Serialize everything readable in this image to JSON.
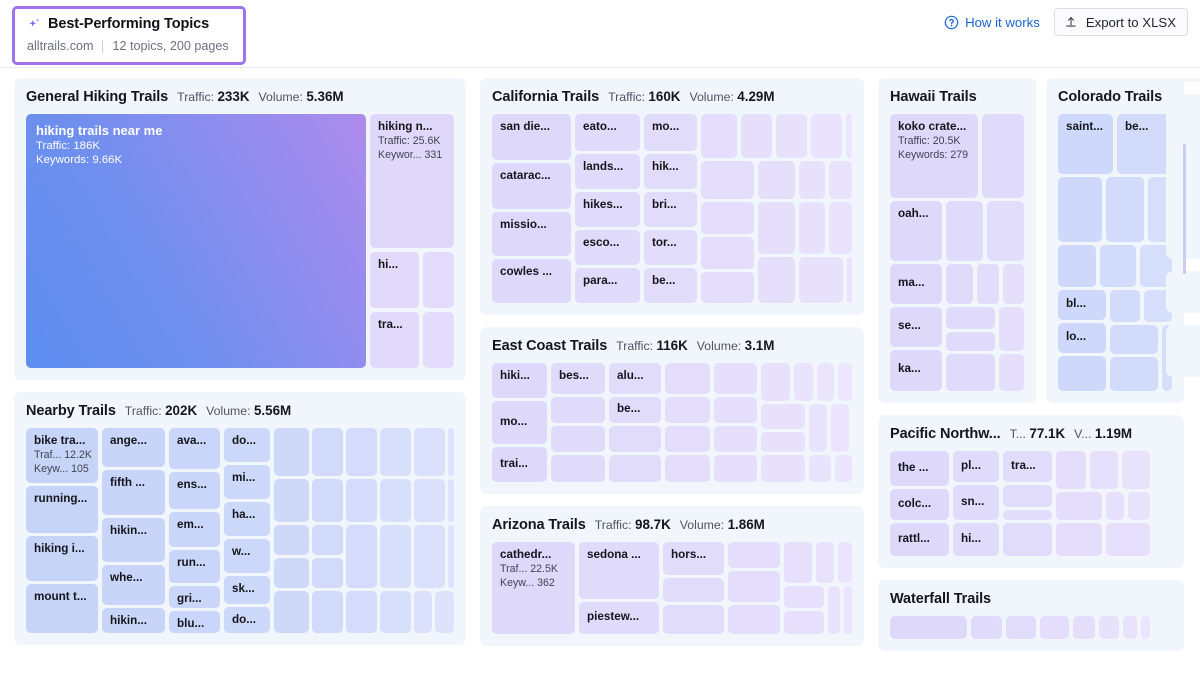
{
  "header": {
    "sparkle_icon": "sparkle-icon",
    "title": "Best-Performing Topics",
    "domain": "alltrails.com",
    "summary": "12 topics, 200 pages",
    "how_it_works": "How it works",
    "how_it_works_icon": "question-circle-icon",
    "export_label": "Export to XLSX",
    "export_icon": "upload-icon"
  },
  "labels": {
    "traffic": "Traffic:",
    "volume": "Volume:"
  },
  "colors": {
    "accent_purple": "#a072ef",
    "link_blue": "#1a63d8",
    "panel_bg": "#f1f5fc",
    "tile_blue": "#c5d3f8",
    "tile_lavender": "#ded9fb",
    "hero_gradient_from": "#5d8ef0",
    "hero_gradient_to": "#ad8bec"
  },
  "chart_data": {
    "type": "treemap",
    "title": "Best-Performing Topics",
    "groups": [
      {
        "name": "General Hiking Trails",
        "traffic": "233K",
        "volume": "5.36M",
        "tiles": [
          {
            "keyword": "hiking trails near me",
            "traffic": "Traffic: 186K",
            "keywords": "Keywords: 9.66K",
            "hero": true
          },
          {
            "keyword": "hiking n...",
            "traffic": "Traffic: 25.6K",
            "keywords": "Keywor... 331"
          },
          {
            "keyword": "hi..."
          },
          {
            "keyword": ""
          },
          {
            "keyword": "tra..."
          },
          {
            "keyword": ""
          }
        ]
      },
      {
        "name": "Nearby Trails",
        "traffic": "202K",
        "volume": "5.56M",
        "tiles": [
          {
            "keyword": "bike tra...",
            "traffic": "Traf...  12.2K",
            "keywords": "Keyw...   105"
          },
          {
            "keyword": "running..."
          },
          {
            "keyword": "hiking i..."
          },
          {
            "keyword": "mount t..."
          },
          {
            "keyword": "ange..."
          },
          {
            "keyword": "fifth ..."
          },
          {
            "keyword": "hikin..."
          },
          {
            "keyword": "whe..."
          },
          {
            "keyword": "hikin..."
          },
          {
            "keyword": "ava..."
          },
          {
            "keyword": "ens..."
          },
          {
            "keyword": "em..."
          },
          {
            "keyword": "run..."
          },
          {
            "keyword": "gri..."
          },
          {
            "keyword": "blu..."
          },
          {
            "keyword": "do..."
          },
          {
            "keyword": "mi..."
          },
          {
            "keyword": "ha..."
          },
          {
            "keyword": "w..."
          },
          {
            "keyword": "sk..."
          },
          {
            "keyword": "do..."
          }
        ]
      },
      {
        "name": "California Trails",
        "traffic": "160K",
        "volume": "4.29M",
        "tiles": [
          {
            "keyword": "san die..."
          },
          {
            "keyword": "catarac..."
          },
          {
            "keyword": "missio..."
          },
          {
            "keyword": "cowles ..."
          },
          {
            "keyword": "eato..."
          },
          {
            "keyword": "lands..."
          },
          {
            "keyword": "hikes..."
          },
          {
            "keyword": "esco..."
          },
          {
            "keyword": "para..."
          },
          {
            "keyword": "mo..."
          },
          {
            "keyword": "hik..."
          },
          {
            "keyword": "bri..."
          },
          {
            "keyword": "tor..."
          },
          {
            "keyword": "be..."
          }
        ]
      },
      {
        "name": "East Coast Trails",
        "traffic": "116K",
        "volume": "3.1M",
        "tiles": [
          {
            "keyword": "hiki..."
          },
          {
            "keyword": "mo..."
          },
          {
            "keyword": "trai..."
          },
          {
            "keyword": "bes..."
          },
          {
            "keyword": "alu..."
          },
          {
            "keyword": "be..."
          }
        ]
      },
      {
        "name": "Arizona Trails",
        "traffic": "98.7K",
        "volume": "1.86M",
        "tiles": [
          {
            "keyword": "cathedr...",
            "traffic": "Traf...  22.5K",
            "keywords": "Keyw...   362"
          },
          {
            "keyword": "sedona ..."
          },
          {
            "keyword": "piestew..."
          },
          {
            "keyword": "hors..."
          }
        ]
      },
      {
        "name": "Hawaii Trails",
        "traffic": "",
        "volume": "",
        "tiles": [
          {
            "keyword": "koko crate...",
            "traffic": "Traffic: 20.5K",
            "keywords": "Keywords: 279"
          },
          {
            "keyword": "oah..."
          },
          {
            "keyword": "ma..."
          },
          {
            "keyword": "se..."
          },
          {
            "keyword": "ka..."
          }
        ]
      },
      {
        "name": "Colorado Trails",
        "traffic": "",
        "volume": "",
        "tiles": [
          {
            "keyword": "saint..."
          },
          {
            "keyword": "be..."
          },
          {
            "keyword": "bl..."
          },
          {
            "keyword": "lo..."
          }
        ]
      },
      {
        "name": "Pacific Northw...",
        "traffic": "77.1K",
        "volume": "1.19M",
        "traffic_label": "T...",
        "volume_label": "V...",
        "tiles": [
          {
            "keyword": "the ..."
          },
          {
            "keyword": "colc..."
          },
          {
            "keyword": "rattl..."
          },
          {
            "keyword": "pl..."
          },
          {
            "keyword": "sn..."
          },
          {
            "keyword": "hi..."
          },
          {
            "keyword": "tra..."
          }
        ]
      },
      {
        "name": "Waterfall Trails",
        "traffic": "",
        "volume": "",
        "tiles": []
      }
    ]
  }
}
